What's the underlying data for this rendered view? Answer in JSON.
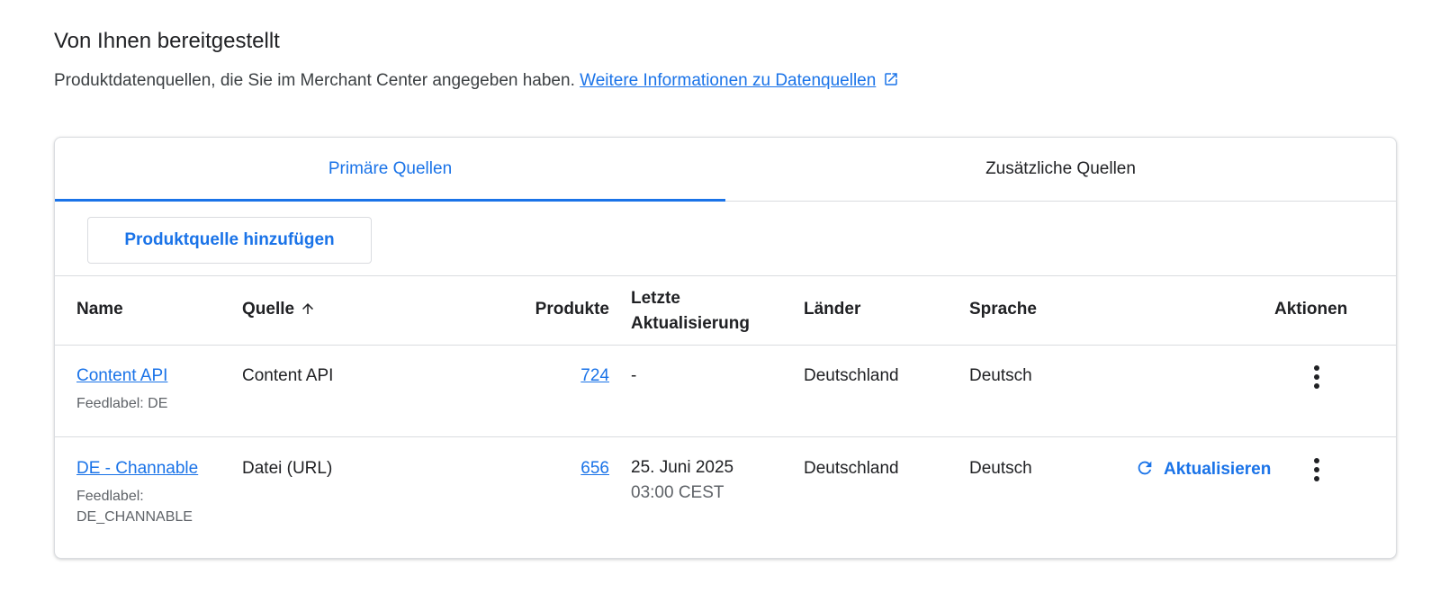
{
  "section": {
    "title": "Von Ihnen bereitgestellt",
    "description": "Produktdatenquellen, die Sie im Merchant Center angegeben haben.",
    "link_text": "Weitere Informationen zu Datenquellen",
    "link_icon": "open-in-new-icon"
  },
  "tabs": [
    {
      "label": "Primäre Quellen",
      "active": true
    },
    {
      "label": "Zusätzliche Quellen",
      "active": false
    }
  ],
  "add_button": "Produktquelle hinzufügen",
  "table": {
    "headers": {
      "name": "Name",
      "source": "Quelle",
      "products": "Produkte",
      "last_update_1": "Letzte",
      "last_update_2": "Aktualisierung",
      "countries": "Länder",
      "language": "Sprache",
      "actions": "Aktionen"
    },
    "rows": [
      {
        "name": "Content API",
        "feedlabel": "Feedlabel: DE",
        "source": "Content API",
        "products": "724",
        "last_update": "-",
        "last_update_time": "",
        "country": "Deutschland",
        "language": "Deutsch"
      },
      {
        "name": "DE - Channable",
        "feedlabel_1": "Feedlabel:",
        "feedlabel_2": "DE_CHANNABLE",
        "source": "Datei (URL)",
        "products": "656",
        "last_update": "25. Juni 2025",
        "last_update_time": "03:00 CEST",
        "country": "Deutschland",
        "language": "Deutsch",
        "refresh_label": "Aktualisieren"
      }
    ]
  },
  "colors": {
    "accent": "#1a73e8",
    "border": "#dadce0",
    "text": "#202124",
    "secondary": "#5f6368"
  }
}
